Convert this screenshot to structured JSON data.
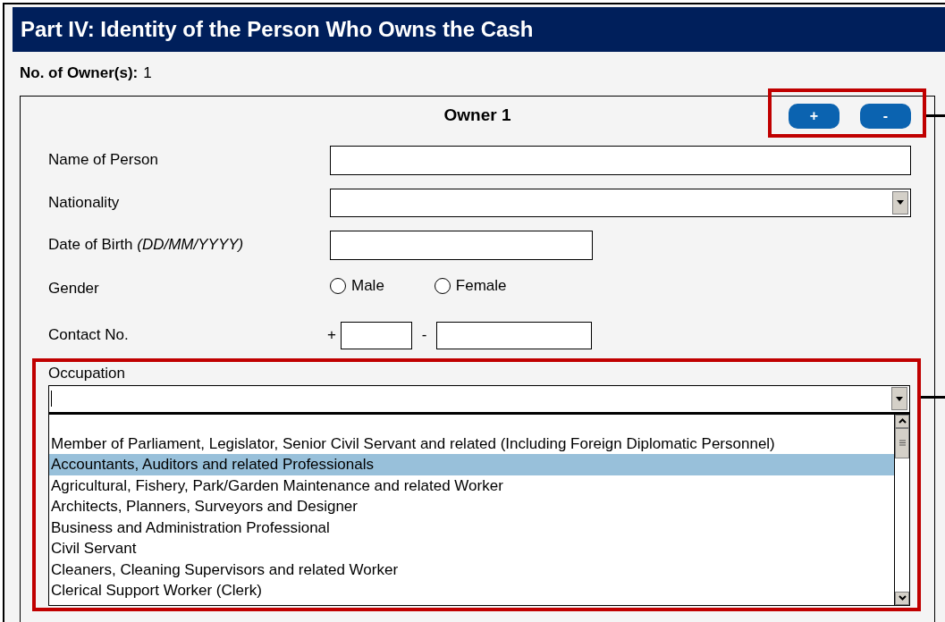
{
  "section": {
    "title": "Part IV: Identity of the Person Who Owns the Cash"
  },
  "owner_count": {
    "label": "No. of Owner(s):",
    "value": "1"
  },
  "owner_card": {
    "title": "Owner 1",
    "buttons": [
      "+",
      "-"
    ],
    "fields": [
      {
        "kind": "text",
        "label": "Name of Person"
      },
      {
        "kind": "select",
        "label": "Nationality"
      },
      {
        "kind": "date",
        "label": "Date of Birth *(DD/MM/YYYY)*"
      },
      {
        "kind": "radio",
        "label": "Gender",
        "options": [
          {
            "label": "Male",
            "selected": false
          },
          {
            "label": "Female",
            "selected": false
          }
        ]
      },
      {
        "kind": "phone",
        "label": "Contact No.",
        "prefix": "+",
        "separator": "-"
      }
    ],
    "occupation": {
      "label": "Occupation",
      "expanded": true,
      "options": [
        {
          "label": "Member of Parliament, Legislator, Senior Civil Servant and related (Including Foreign Diplomatic Personnel)",
          "selected": false
        },
        {
          "label": "Accountants, Auditors and related Professionals",
          "selected": true
        },
        {
          "label": "Agricultural, Fishery, Park/Garden Maintenance and related Worker",
          "selected": false
        },
        {
          "label": "Architects, Planners, Surveyors and Designer",
          "selected": false
        },
        {
          "label": "Business and Administration Professional",
          "selected": false
        },
        {
          "label": "Civil Servant",
          "selected": false
        },
        {
          "label": "Cleaners, Cleaning Supervisors and related Worker",
          "selected": false
        },
        {
          "label": "Clerical Support Worker (Clerk)",
          "selected": false
        }
      ]
    }
  }
}
